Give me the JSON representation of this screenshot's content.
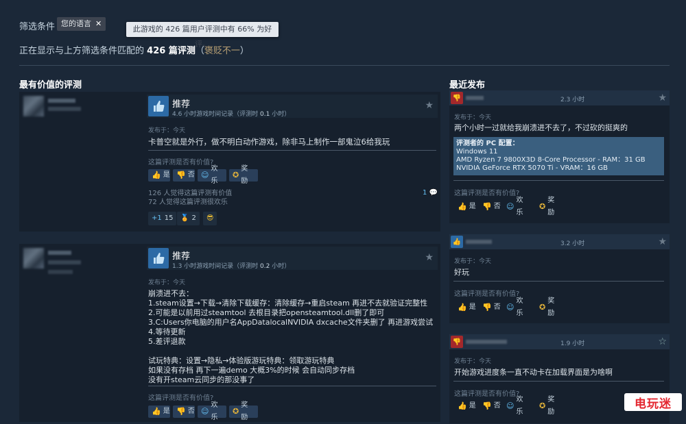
{
  "filter": {
    "label": "筛选条件",
    "chip": "您的语言",
    "chip_close": "✕",
    "tooltip": "此游戏的 426 篇用户评测中有 66% 为好评。"
  },
  "summary": {
    "prefix": "正在显示与上方筛选条件匹配的",
    "count": "426 篇评测",
    "open_paren": "（",
    "verdict": "褒贬不一",
    "close_paren": "）",
    "verdict_color": "#b9a074"
  },
  "left_section_title": "最有价值的评测",
  "right_section_title": "最近发布",
  "reviews_left": [
    {
      "recommend": "推荐",
      "hours_a": "4.6 小时游戏时间记录（评测时 ",
      "hours_b": "0.1",
      "hours_c": " 小时）",
      "posted": "发布于：今天",
      "body": [
        "卡普空就是外行，做不明白动作游戏，除非马上制作一部鬼泣6给我玩"
      ],
      "helpful_q": "这篇评测是否有价值?",
      "buttons": {
        "yes": "是",
        "no": "否",
        "funny": "欢乐",
        "award": "奖励"
      },
      "stats": [
        "126 人觉得这篇评测有价值",
        "72 人觉得这篇评测很欢乐"
      ],
      "comments": "1",
      "reactions": [
        {
          "icon": "plus-one-icon",
          "count": "15"
        },
        {
          "icon": "medal-icon",
          "count": "2"
        },
        {
          "icon": "emoji-icon",
          "count": ""
        }
      ]
    },
    {
      "recommend": "推荐",
      "hours_a": "1.3 小时游戏时间记录（评测时 ",
      "hours_b": "0.2",
      "hours_c": " 小时）",
      "posted": "发布于：今天",
      "body": [
        "崩溃进不去：",
        "1.steam设置→下载→清除下载缓存：清除缓存→重启steam 再进不去就验证完整性",
        "2.可能是以前用过steamtool 去根目录把opensteamtool.dll删了即可",
        "3.C:Users你电脑的用户名AppDatalocalNVIDIA dxcache文件夹删了 再进游戏尝试",
        "4.等待更新",
        "5.差评退款",
        "",
        "试玩特典：设置→隐私→体验版游玩特典：领取游玩特典",
        "如果没有存档 再下一遍demo 大概3%的时候 会自动同步存档",
        "没有开steam云同步的那没事了"
      ],
      "helpful_q": "这篇评测是否有价值?",
      "buttons": {
        "yes": "是",
        "no": "否",
        "funny": "欢乐",
        "award": "奖励"
      }
    }
  ],
  "reviews_right": [
    {
      "thumb": "down",
      "hours": "2.3 小时",
      "posted": "发布于：今天",
      "body": "两个小时一过就给我崩溃进不去了，不过砍的挺爽的",
      "pc_title": "评测者的 PC 配置：",
      "pc_lines": [
        "Windows 11",
        "AMD Ryzen 7 9800X3D 8-Core Processor - RAM：31 GB",
        "NVIDIA GeForce RTX 5070 Ti - VRAM：16 GB"
      ],
      "helpful_q": "这篇评测是否有价值?",
      "buttons": {
        "yes": "是",
        "no": "否",
        "funny": "欢乐",
        "award": "奖励"
      }
    },
    {
      "thumb": "up",
      "hours": "3.2 小时",
      "posted": "发布于：今天",
      "body": "好玩",
      "helpful_q": "这篇评测是否有价值?",
      "buttons": {
        "yes": "是",
        "no": "否",
        "funny": "欢乐",
        "award": "奖励"
      }
    },
    {
      "thumb": "down",
      "hours": "1.9 小时",
      "posted": "发布于：今天",
      "body": "开始游戏进度条一直不动卡在加载界面是为啥啊",
      "helpful_q": "这篇评测是否有价值?",
      "buttons": {
        "yes": "是",
        "no": "否",
        "funny": "欢乐",
        "award": "奖励"
      }
    }
  ],
  "watermark": "电玩迷",
  "colors": {
    "background": "#1b2838",
    "accent": "#66c0f4",
    "thumb_up": "#2c6aa5",
    "thumb_down": "#a3282b"
  }
}
